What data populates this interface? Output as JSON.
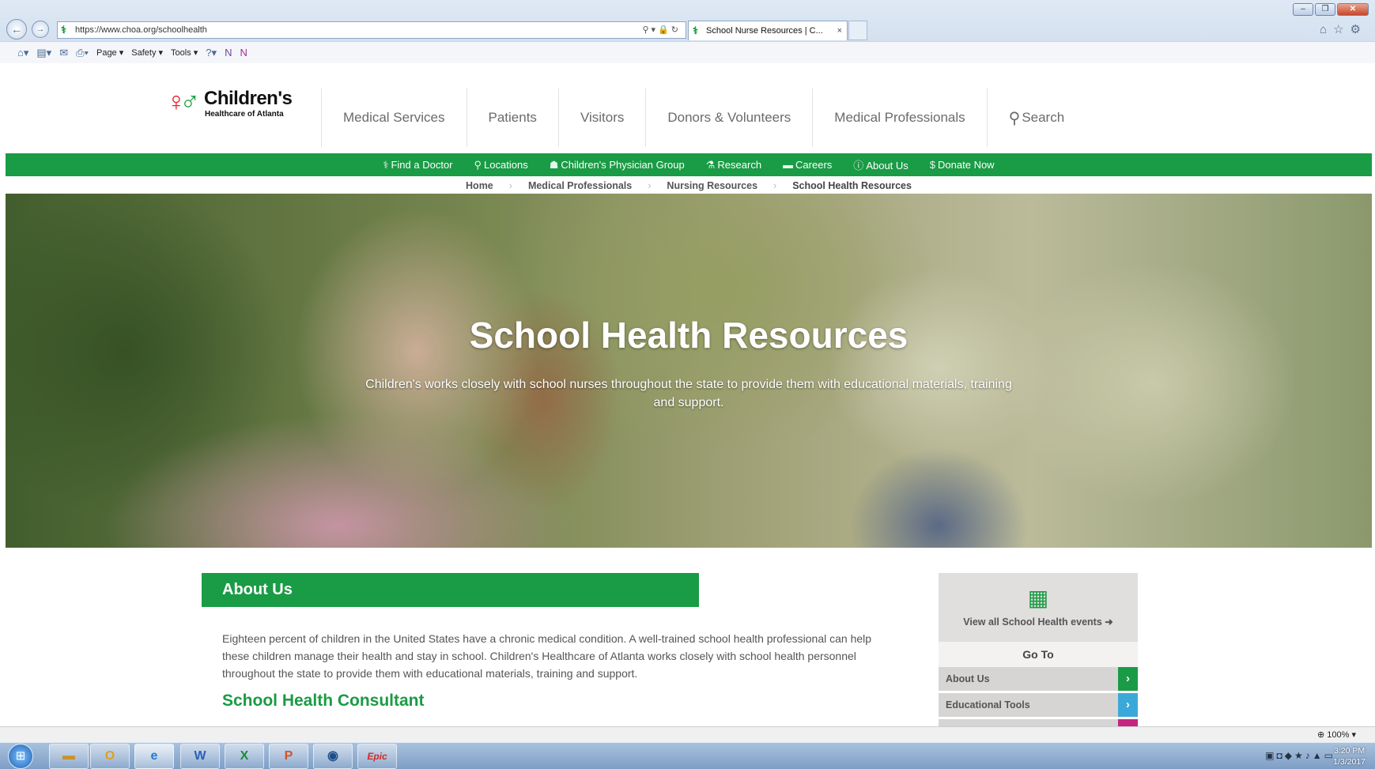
{
  "browser": {
    "url": "https://www.choa.org/schoolhealth",
    "tab_title": "School Nurse Resources | C...",
    "tab_close": "×",
    "commands": [
      "Page ▾",
      "Safety ▾",
      "Tools ▾"
    ],
    "zoom": "100%"
  },
  "site": {
    "logo": {
      "name": "Children's",
      "subtitle": "Healthcare of Atlanta"
    },
    "main_nav": [
      "Medical Services",
      "Patients",
      "Visitors",
      "Donors & Volunteers",
      "Medical Professionals"
    ],
    "search_label": "Search",
    "utility_nav": [
      {
        "icon": "stethoscope-icon",
        "label": "Find a Doctor"
      },
      {
        "icon": "map-pin-icon",
        "label": "Locations"
      },
      {
        "icon": "people-icon",
        "label": "Children's Physician Group"
      },
      {
        "icon": "flask-icon",
        "label": "Research"
      },
      {
        "icon": "briefcase-icon",
        "label": "Careers"
      },
      {
        "icon": "info-icon",
        "label": "About Us"
      },
      {
        "icon": "dollar-icon",
        "label": "Donate Now"
      }
    ],
    "breadcrumbs": [
      "Home",
      "Medical Professionals",
      "Nursing Resources",
      "School Health Resources"
    ]
  },
  "hero": {
    "title": "School Health Resources",
    "subtitle": "Children's works closely with school nurses throughout the state to provide them with educational materials, training and support."
  },
  "content": {
    "section_heading": "About Us",
    "paragraph": "Eighteen percent of children in the United States have a chronic medical condition. A well-trained school health professional can help these children manage their health and stay in school. Children's Healthcare of Atlanta works closely with school health personnel throughout the state to provide them with educational materials, training and support.",
    "subheading": "School Health Consultant"
  },
  "sidebar": {
    "events_link": "View all School Health events",
    "goto_label": "Go To",
    "links": [
      {
        "label": "About Us",
        "color": "#1a9b45"
      },
      {
        "label": "Educational Tools",
        "color": "#3aa9d9"
      }
    ]
  },
  "taskbar": {
    "apps": [
      "Explorer",
      "Outlook",
      "Internet Explorer",
      "Word",
      "Excel",
      "PowerPoint",
      "Skype",
      "Epic"
    ],
    "time": "3:20 PM",
    "date": "1/3/2017"
  },
  "colors": {
    "brand_green": "#1a9b45",
    "accent_blue": "#3aa9d9",
    "accent_magenta": "#c4267f"
  }
}
